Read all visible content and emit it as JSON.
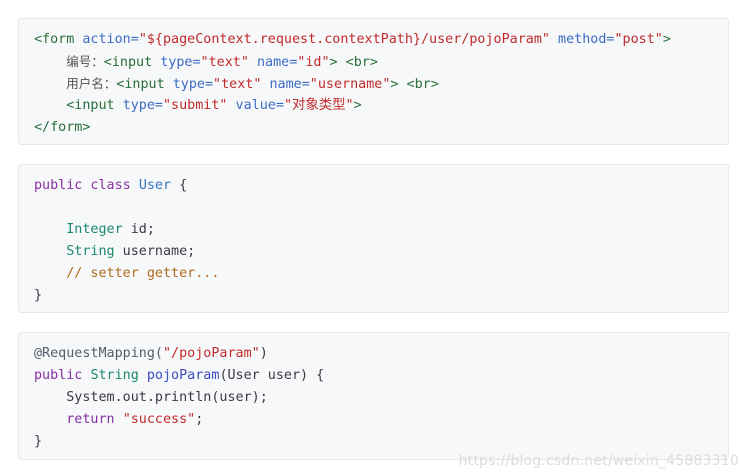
{
  "block1": {
    "lines": [
      [
        "<form ",
        "action=",
        "\"${pageContext.request.contextPath}/user/pojoParam\"",
        " method=",
        "\"post\"",
        ">"
      ],
      [
        "    ",
        "编号：",
        "<input ",
        "type=",
        "\"text\"",
        " name=",
        "\"id\"",
        "> ",
        "<br>"
      ],
      [
        "    ",
        "用户名：",
        "<input ",
        "type=",
        "\"text\"",
        " name=",
        "\"username\"",
        "> ",
        "<br>"
      ],
      [
        "    ",
        "<input ",
        "type=",
        "\"submit\"",
        " value=",
        "\"对象类型\"",
        ">"
      ],
      [
        "</form>"
      ]
    ]
  },
  "block2": {
    "line1_kw": "public class ",
    "line1_cls": "User",
    "line1_brace": " {",
    "line3_type": "Integer",
    "line3_rest": " id;",
    "line4_type": "String",
    "line4_rest": " username;",
    "line5_cmt": "// setter getter...",
    "line6": "}"
  },
  "block3": {
    "line1_ann": "@RequestMapping(",
    "line1_str": "\"/pojoParam\"",
    "line1_end": ")",
    "line2_kw": "public ",
    "line2_type": "String",
    "line2_fn": " pojoParam",
    "line2_rest": "(User user) {",
    "line3": "System.out.println(user);",
    "line4_kw": "return ",
    "line4_str": "\"success\"",
    "line4_end": ";",
    "line5": "}"
  },
  "watermark": "https://blog.csdn.net/weixin_45883310"
}
